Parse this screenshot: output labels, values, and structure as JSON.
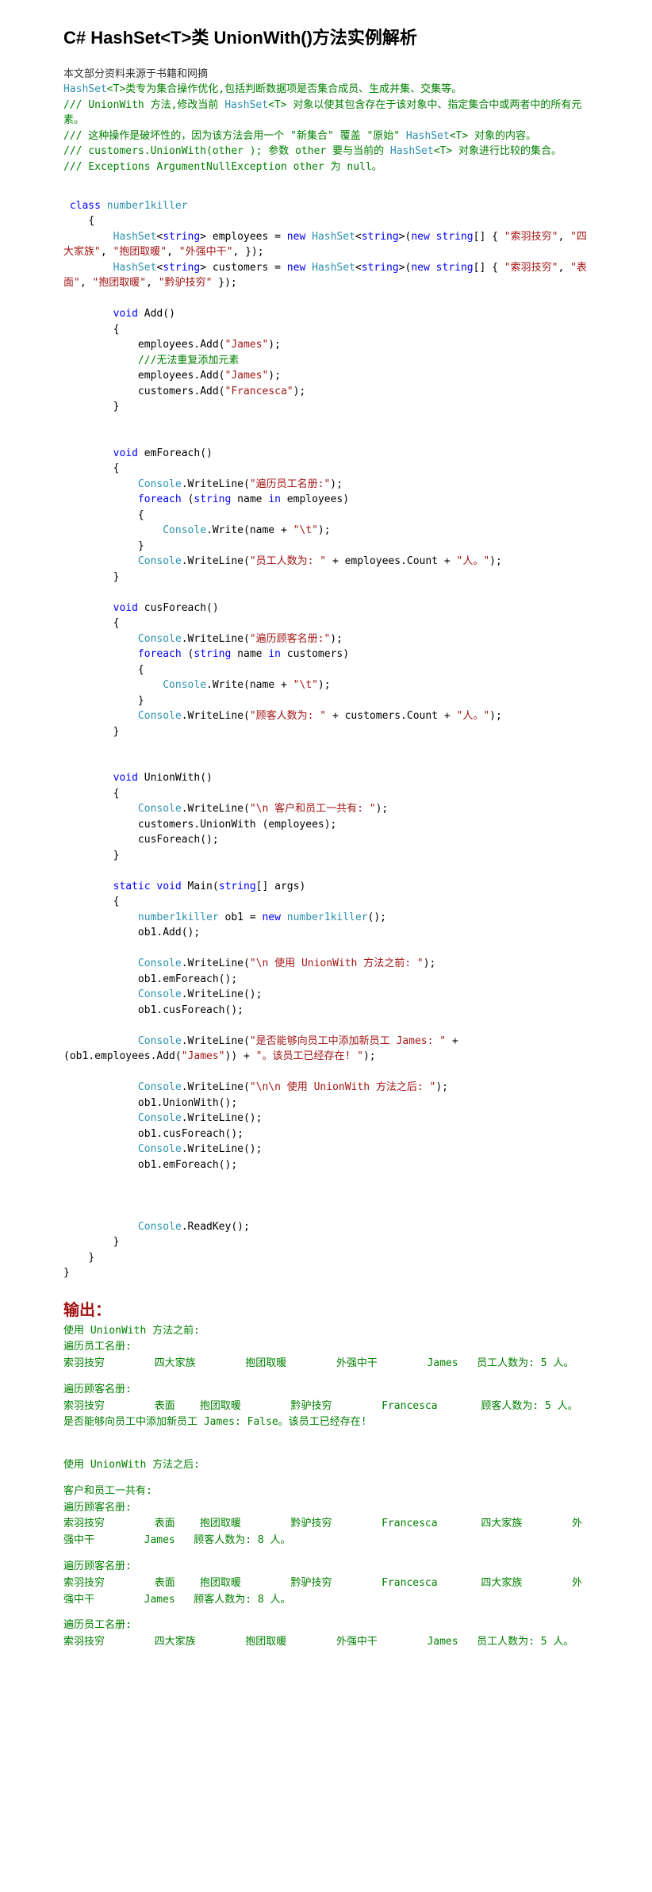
{
  "title": "C# HashSet<T>类 UnionWith()方法实例解析",
  "source_note": "本文部分资料来源于书籍和网摘",
  "intro_lines": [
    {
      "pre": "",
      "mid": "HashSet",
      "gen": "<T>",
      "post": "类专为集合操作优化,包括判断数据项是否集合成员、生成并集、交集等。"
    },
    {
      "pre": "/// UnionWith 方法,修改当前 ",
      "mid": "HashSet",
      "gen": "<T>",
      "post": " 对象以使其包含存在于该对象中、指定集合中或两者中的所有元素。"
    },
    {
      "pre": "/// 这种操作是破坏性的，因为该方法会用一个 \"新集合\" 覆盖 \"原始\" ",
      "mid": "HashSet",
      "gen": "<T>",
      "post": " 对象的内容。"
    },
    {
      "pre": "///   customers.UnionWith(other ); 参数 other 要与当前的 ",
      "mid": "HashSet",
      "gen": "<T>",
      "post": " 对象进行比较的集合。"
    },
    {
      "pre": "/// Exceptions ArgumentNullException  other 为 null。",
      "mid": "",
      "gen": "",
      "post": ""
    }
  ],
  "code": {
    "cls_kw": "class",
    "cls_name": "number1killer",
    "tp_hashset": "HashSet",
    "tp_string": "string",
    "kw_new": "new",
    "emp_arr": [
      "\"索羽技穷\"",
      "\"四大家族\"",
      "\"抱团取暖\"",
      "\"外强中干\""
    ],
    "cus_arr": [
      "\"索羽技穷\"",
      "\"表面\"",
      "\"抱团取暖\"",
      "\"黔驴技穷\""
    ],
    "kw_void": "void",
    "m_add": "Add()",
    "s_james": "\"James\"",
    "cm_dup": "///无法重复添加元素",
    "s_fran": "\"Francesca\"",
    "m_emf": "emForeach()",
    "tp_console": "Console",
    "s_emlist": "\"遍历员工名册:\"",
    "kw_foreach": "foreach",
    "kw_in": "in",
    "s_tab": "\"\\t\"",
    "s_emcount": "\"员工人数为: \"",
    "s_ren": "\"人。\"",
    "m_cusf": "cusForeach()",
    "s_cuslist": "\"遍历顾客名册:\"",
    "s_cuscount": "\"顾客人数为: \"",
    "m_union": "UnionWith()",
    "s_unionhead": "\"\\n 客户和员工一共有: \"",
    "kw_static": "static",
    "m_main": "Main",
    "kw_args": "args",
    "s_before": "\"\\n 使用 UnionWith 方法之前: \"",
    "s_addjames": "\"是否能够向员工中添加新员工 James: \"",
    "s_exists": "\"。该员工已经存在! \"",
    "s_after": "\"\\n\\n 使用 UnionWith 方法之后: \""
  },
  "output_title": "输出：",
  "output": {
    "l1": "使用 UnionWith 方法之前:",
    "l2": "遍历员工名册:",
    "l3": "索羽技穷        四大家族        抱团取暖        外强中干        James   员工人数为: 5 人。",
    "l4": "遍历顾客名册:",
    "l5": "索羽技穷        表面    抱团取暖        黔驴技穷        Francesca       顾客人数为: 5 人。",
    "l6": "是否能够向员工中添加新员工 James: False。该员工已经存在!",
    "l7": "使用 UnionWith 方法之后:",
    "l8": "客户和员工一共有:",
    "l9": "遍历顾客名册:",
    "l10": "索羽技穷        表面    抱团取暖        黔驴技穷        Francesca       四大家族        外强中干        James   顾客人数为: 8 人。",
    "l11": "遍历顾客名册:",
    "l12": "索羽技穷        表面    抱团取暖        黔驴技穷        Francesca       四大家族        外强中干        James   顾客人数为: 8 人。",
    "l13": "遍历员工名册:",
    "l14": "索羽技穷        四大家族        抱团取暖        外强中干        James   员工人数为: 5 人。"
  }
}
